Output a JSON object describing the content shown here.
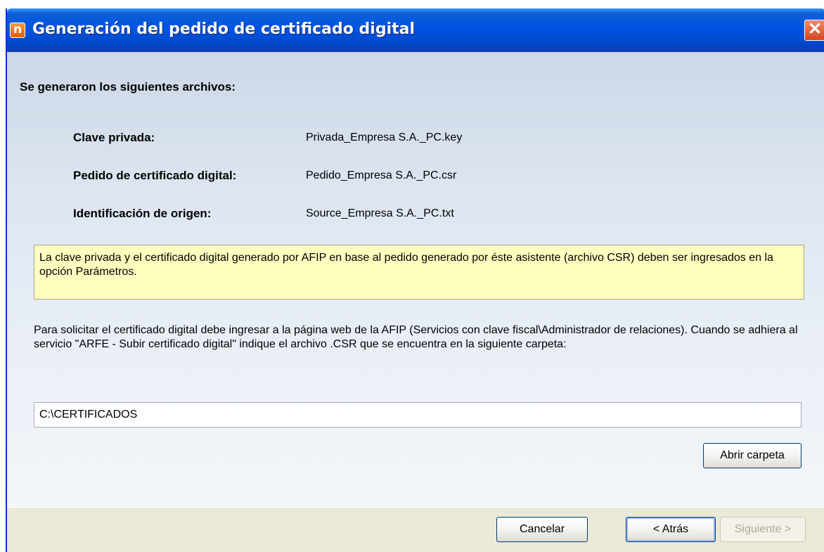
{
  "window": {
    "title": "Generación del pedido de certificado digital",
    "icon_letter": "n",
    "close_glyph": "✕"
  },
  "main": {
    "heading": "Se generaron los siguientes archivos:",
    "files": [
      {
        "label": "Clave privada:",
        "value": "Privada_Empresa S.A._PC.key"
      },
      {
        "label": "Pedido de certificado digital:",
        "value": "Pedido_Empresa S.A._PC.csr"
      },
      {
        "label": "Identificación de origen:",
        "value": "Source_Empresa S.A._PC.txt"
      }
    ],
    "note": "La clave privada y el certificado digital generado por AFIP en base al pedido generado por éste asistente (archivo CSR) deben ser ingresados en la opción Parámetros.",
    "instructions": "Para solicitar el certificado digital debe ingresar a la página web de la AFIP (Servicios con clave fiscal\\Administrador de relaciones). Cuando se adhiera al servicio \"ARFE - Subir certificado digital\" indique el archivo .CSR que se encuentra en la siguiente carpeta:",
    "folder_path": "C:\\CERTIFICADOS",
    "open_folder_label": "Abrir carpeta"
  },
  "footer": {
    "cancel_label": "Cancelar",
    "back_label": "< Atrás",
    "next_label": "Siguiente >"
  },
  "colors": {
    "titlebar": "#0054e3",
    "note_background": "#ffffc0",
    "dialog_face": "#ece9d8",
    "close_button": "#d6431a"
  },
  "icons": [
    "app-icon",
    "close-icon"
  ]
}
